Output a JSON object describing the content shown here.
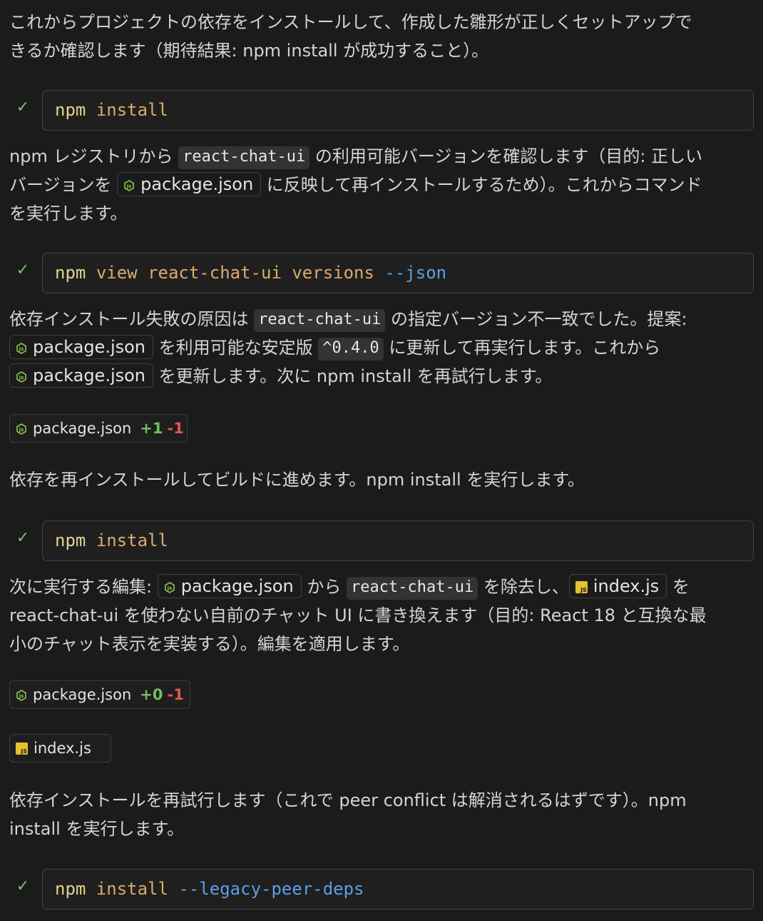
{
  "colors": {
    "background": "#1b1b1b",
    "text": "#d4d4d4",
    "check": "#7bbf72",
    "command": "#e2d48a",
    "argument": "#dcaa6e",
    "flag": "#5aa0e6",
    "additions": "#6fbf5f",
    "deletions": "#e2554f"
  },
  "icons": {
    "check": "check-icon",
    "json_file": "nodejs-json-file-icon",
    "js_file": "js-file-icon"
  },
  "p1": {
    "l1": "これからプロジェクトの依存をインストールして、作成した雛形が正しくセットアップで",
    "l2": "きるか確認します（期待結果: npm install が成功すること）。"
  },
  "cmd1": {
    "cmd": "npm",
    "arg": "install"
  },
  "p2": {
    "l1a": "npm レジストリから ",
    "code1": "react-chat-ui",
    "l1b": " の利用可能バージョンを確認します（目的: 正しい",
    "l2a": "バージョンを ",
    "file1": "package.json",
    "l2b": " に反映して再インストールするため）。これからコマンド",
    "l3": "を実行します。"
  },
  "cmd2": {
    "cmd": "npm",
    "arg1": "view",
    "arg2": "react-chat-ui",
    "arg3": "versions",
    "flag": "--json"
  },
  "p3": {
    "l1a": "依存インストール失敗の原因は ",
    "code1": "react-chat-ui",
    "l1b": " の指定バージョン不一致でした。提案:",
    "file1": "package.json",
    "l2a": " を利用可能な安定版 ",
    "code2": "^0.4.0",
    "l2b": " に更新して再実行します。これから",
    "file2": "package.json",
    "l3b": " を更新します。次に npm install を再試行します。"
  },
  "edit1": {
    "file": "package.json",
    "added": "+1",
    "removed": "-1"
  },
  "p4": {
    "l1": "依存を再インストールしてビルドに進めます。npm install を実行します。"
  },
  "cmd3": {
    "cmd": "npm",
    "arg": "install"
  },
  "p5": {
    "l1a": "次に実行する編集: ",
    "file1": "package.json",
    "l1b": " から ",
    "code1": "react-chat-ui",
    "l1c": " を除去し、",
    "file2": "index.js",
    "l1d": " を",
    "l2": "react-chat-ui を使わない自前のチャット UI に書き換えます（目的: React 18 と互換な最",
    "l3": "小のチャット表示を実装する）。編集を適用します。"
  },
  "edit2": {
    "file": "package.json",
    "added": "+0",
    "removed": "-1"
  },
  "edit3": {
    "file": "index.js"
  },
  "p6": {
    "l1": "依存インストールを再試行します（これで peer conflict は解消されるはずです）。npm",
    "l2": "install を実行します。"
  },
  "cmd4": {
    "cmd": "npm",
    "arg": "install",
    "flag": "--legacy-peer-deps"
  }
}
